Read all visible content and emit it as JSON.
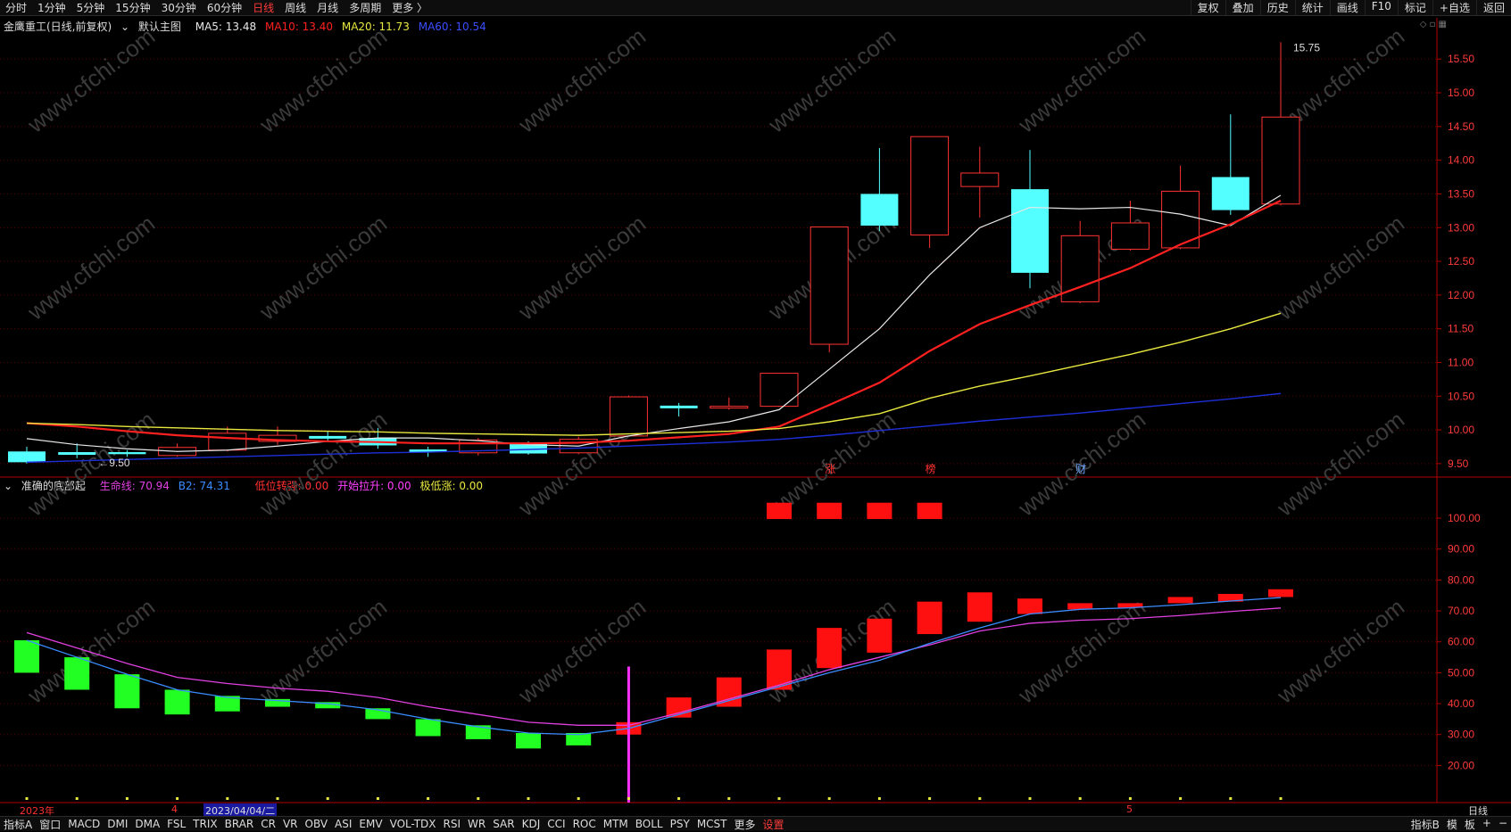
{
  "toolbar": {
    "periods": [
      "分时",
      "1分钟",
      "5分钟",
      "15分钟",
      "30分钟",
      "60分钟",
      "日线",
      "周线",
      "月线",
      "多周期",
      "更多 〉"
    ],
    "active_period": "日线",
    "right_buttons": [
      "复权",
      "叠加",
      "历史",
      "统计",
      "画线",
      "F10",
      "标记",
      "+自选",
      "返回"
    ]
  },
  "main_legend": {
    "title": "金鹰重工(日线,前复权)",
    "template": "默认主图",
    "ma5": "MA5: 13.48",
    "ma10": "MA10: 13.40",
    "ma20": "MA20: 11.73",
    "ma60": "MA60: 10.54"
  },
  "sub_legend": {
    "title": "准确的底部起",
    "lifeline": "生命线: 70.94",
    "b2": "B2: 74.31",
    "low_turn": "低位转强: 0.00",
    "start_rise": "开始拉升: 0.00",
    "extreme_low": "极低涨: 0.00"
  },
  "colors": {
    "up": "#ff3232",
    "down": "#54ffff",
    "ma5": "#e8e8e8",
    "ma10": "#ff2020",
    "ma20": "#e8e840",
    "ma60": "#1e2fd8",
    "lifeline": "#e040e0",
    "b2": "#3a8cff",
    "green_bar": "#22ff22",
    "red_bar": "#ff1010",
    "grid": "#5a0000"
  },
  "chart_data": [
    {
      "type": "candlestick",
      "title": "金鹰重工(日线,前复权)",
      "ylim": [
        9.3,
        15.9
      ],
      "y_ticks": [
        9.5,
        10.0,
        10.5,
        11.0,
        11.5,
        12.0,
        12.5,
        13.0,
        13.5,
        14.0,
        14.5,
        15.0,
        15.5
      ],
      "candles": [
        {
          "o": 9.68,
          "c": 9.52,
          "h": 9.75,
          "l": 9.5
        },
        {
          "o": 9.67,
          "c": 9.63,
          "h": 9.8,
          "l": 9.58
        },
        {
          "o": 9.67,
          "c": 9.64,
          "h": 9.7,
          "l": 9.6
        },
        {
          "o": 9.62,
          "c": 9.74,
          "h": 9.8,
          "l": 9.6
        },
        {
          "o": 9.7,
          "c": 9.95,
          "h": 10.05,
          "l": 9.68
        },
        {
          "o": 9.83,
          "c": 9.92,
          "h": 10.05,
          "l": 9.78
        },
        {
          "o": 9.91,
          "c": 9.87,
          "h": 9.98,
          "l": 9.82
        },
        {
          "o": 9.88,
          "c": 9.77,
          "h": 10.03,
          "l": 9.72
        },
        {
          "o": 9.71,
          "c": 9.67,
          "h": 9.75,
          "l": 9.6
        },
        {
          "o": 9.66,
          "c": 9.85,
          "h": 9.88,
          "l": 9.62
        },
        {
          "o": 9.79,
          "c": 9.65,
          "h": 9.83,
          "l": 9.63
        },
        {
          "o": 9.66,
          "c": 9.86,
          "h": 9.9,
          "l": 9.64
        },
        {
          "o": 9.91,
          "c": 10.49,
          "h": 10.51,
          "l": 9.9
        },
        {
          "o": 10.36,
          "c": 10.32,
          "h": 10.4,
          "l": 10.2
        },
        {
          "o": 10.35,
          "c": 10.35,
          "h": 10.48,
          "l": 10.3
        },
        {
          "o": 10.35,
          "c": 10.84,
          "h": 10.84,
          "l": 10.34
        },
        {
          "o": 11.27,
          "c": 13.01,
          "h": 13.01,
          "l": 11.15
        },
        {
          "o": 13.5,
          "c": 13.03,
          "h": 14.18,
          "l": 12.95
        },
        {
          "o": 12.89,
          "c": 14.35,
          "h": 14.35,
          "l": 12.7
        },
        {
          "o": 13.61,
          "c": 13.81,
          "h": 14.2,
          "l": 13.15
        },
        {
          "o": 13.57,
          "c": 12.33,
          "h": 14.15,
          "l": 12.1
        },
        {
          "o": 11.9,
          "c": 12.88,
          "h": 13.1,
          "l": 11.88
        },
        {
          "o": 12.68,
          "c": 13.07,
          "h": 13.4,
          "l": 12.66
        },
        {
          "o": 12.7,
          "c": 13.54,
          "h": 13.92,
          "l": 12.68
        },
        {
          "o": 13.75,
          "c": 13.26,
          "h": 14.68,
          "l": 13.19
        },
        {
          "o": 13.35,
          "c": 14.64,
          "h": 15.75,
          "l": 13.33
        }
      ],
      "series": [
        {
          "name": "MA5",
          "values": [
            9.87,
            9.78,
            9.72,
            9.68,
            9.7,
            9.76,
            9.83,
            9.88,
            9.88,
            9.84,
            9.78,
            9.76,
            9.91,
            10.02,
            10.12,
            10.3,
            10.9,
            11.5,
            12.3,
            13.0,
            13.3,
            13.28,
            13.3,
            13.2,
            13.03,
            13.48
          ]
        },
        {
          "name": "MA10",
          "values": [
            10.1,
            10.05,
            9.98,
            9.92,
            9.88,
            9.85,
            9.83,
            9.82,
            9.8,
            9.8,
            9.8,
            9.81,
            9.84,
            9.89,
            9.94,
            10.05,
            10.37,
            10.7,
            11.17,
            11.57,
            11.85,
            12.12,
            12.4,
            12.75,
            13.05,
            13.4
          ]
        },
        {
          "name": "MA20",
          "values": [
            10.1,
            10.08,
            10.05,
            10.03,
            10.01,
            9.99,
            9.98,
            9.97,
            9.95,
            9.94,
            9.93,
            9.92,
            9.94,
            9.96,
            9.98,
            10.02,
            10.12,
            10.24,
            10.47,
            10.65,
            10.8,
            10.96,
            11.12,
            11.3,
            11.5,
            11.73
          ]
        },
        {
          "name": "MA60",
          "values": [
            9.52,
            9.54,
            9.56,
            9.58,
            9.6,
            9.62,
            9.64,
            9.66,
            9.67,
            9.69,
            9.71,
            9.73,
            9.76,
            9.79,
            9.82,
            9.86,
            9.92,
            9.99,
            10.06,
            10.13,
            10.19,
            10.25,
            10.32,
            10.39,
            10.46,
            10.54
          ]
        }
      ],
      "annotations": {
        "high": "15.75",
        "low": "9.50",
        "marks": [
          {
            "index": 16,
            "text": "涨"
          },
          {
            "index": 18,
            "text": "榜"
          },
          {
            "index": 21,
            "text": "财"
          }
        ]
      }
    },
    {
      "type": "bar",
      "title": "准确的底部起",
      "ylim": [
        8,
        113
      ],
      "y_ticks": [
        20.0,
        30.0,
        40.0,
        50.0,
        60.0,
        70.0,
        80.0,
        90.0,
        100.0
      ],
      "bars": [
        {
          "top": 60.5,
          "bottom": 50.0,
          "color": "green"
        },
        {
          "top": 55.0,
          "bottom": 44.5,
          "color": "green"
        },
        {
          "top": 49.5,
          "bottom": 38.5,
          "color": "green"
        },
        {
          "top": 44.5,
          "bottom": 36.5,
          "color": "green"
        },
        {
          "top": 42.5,
          "bottom": 37.5,
          "color": "green"
        },
        {
          "top": 41.5,
          "bottom": 39.0,
          "color": "green"
        },
        {
          "top": 40.5,
          "bottom": 38.5,
          "color": "green"
        },
        {
          "top": 38.5,
          "bottom": 35.0,
          "color": "green"
        },
        {
          "top": 35.0,
          "bottom": 29.5,
          "color": "green"
        },
        {
          "top": 33.0,
          "bottom": 28.5,
          "color": "green"
        },
        {
          "top": 30.5,
          "bottom": 25.5,
          "color": "green"
        },
        {
          "top": 30.5,
          "bottom": 26.5,
          "color": "green"
        },
        {
          "top": 34.0,
          "bottom": 30.0,
          "color": "red"
        },
        {
          "top": 42.0,
          "bottom": 35.5,
          "color": "red"
        },
        {
          "top": 48.5,
          "bottom": 39.0,
          "color": "red"
        },
        {
          "top": 57.5,
          "bottom": 44.5,
          "color": "red"
        },
        {
          "top": 64.5,
          "bottom": 51.5,
          "color": "red"
        },
        {
          "top": 67.5,
          "bottom": 56.5,
          "color": "red"
        },
        {
          "top": 73.0,
          "bottom": 62.5,
          "color": "red"
        },
        {
          "top": 76.0,
          "bottom": 66.5,
          "color": "red"
        },
        {
          "top": 74.0,
          "bottom": 69.0,
          "color": "red"
        },
        {
          "top": 72.5,
          "bottom": 70.5,
          "color": "red"
        },
        {
          "top": 72.5,
          "bottom": 71.0,
          "color": "red"
        },
        {
          "top": 74.5,
          "bottom": 72.5,
          "color": "red"
        },
        {
          "top": 75.5,
          "bottom": 73.0,
          "color": "red"
        },
        {
          "top": 77.0,
          "bottom": 74.5,
          "color": "red"
        }
      ],
      "top_blocks": [
        15,
        16,
        17,
        18
      ],
      "signal_index": 12,
      "series": [
        {
          "name": "生命线",
          "values": [
            63.0,
            58.0,
            53.0,
            48.5,
            46.5,
            45.0,
            44.0,
            42.0,
            39.0,
            36.5,
            34.0,
            33.0,
            33.0,
            37.0,
            41.5,
            46.0,
            51.0,
            55.0,
            59.0,
            63.5,
            66.0,
            67.0,
            67.5,
            68.5,
            69.8,
            70.94
          ]
        },
        {
          "name": "B2",
          "values": [
            60.5,
            55.0,
            49.5,
            44.5,
            42.0,
            41.0,
            40.0,
            38.0,
            35.0,
            32.5,
            30.5,
            30.0,
            32.0,
            36.5,
            41.0,
            45.5,
            50.0,
            54.0,
            59.5,
            64.5,
            69.0,
            70.5,
            71.0,
            72.0,
            73.2,
            74.31
          ]
        }
      ]
    }
  ],
  "date_axis": {
    "labels": [
      "2023年",
      "4",
      "2023/04/04/二",
      "5"
    ]
  },
  "period_label": "日线",
  "bottom_tabs": [
    "指标A",
    "窗口",
    "MACD",
    "DMI",
    "DMA",
    "FSL",
    "TRIX",
    "BRAR",
    "CR",
    "VR",
    "OBV",
    "ASI",
    "EMV",
    "VOL-TDX",
    "RSI",
    "WR",
    "SAR",
    "KDJ",
    "CCI",
    "ROC",
    "MTM",
    "BOLL",
    "PSY",
    "MCST",
    "更多",
    "设置"
  ],
  "bottom_right": [
    "指标B",
    "模",
    "板",
    "+",
    "−"
  ],
  "watermark": "www.cfchi.com"
}
